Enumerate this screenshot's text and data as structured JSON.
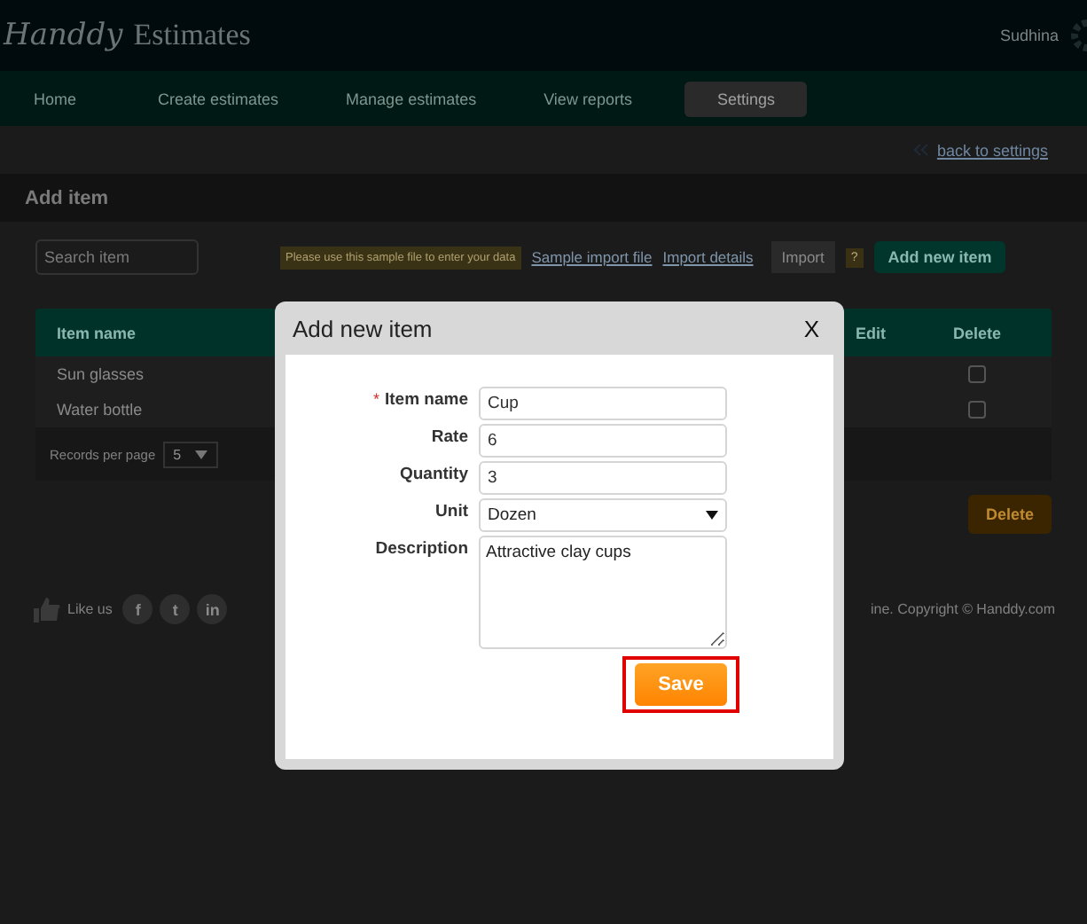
{
  "header": {
    "logo_script": "Handdy",
    "logo_text": "Estimates",
    "user": "Sudhina"
  },
  "nav": [
    {
      "label": "Home",
      "selected": false
    },
    {
      "label": "Create estimates",
      "selected": false
    },
    {
      "label": "Manage estimates",
      "selected": false
    },
    {
      "label": "View reports",
      "selected": false
    },
    {
      "label": "Settings",
      "selected": true
    }
  ],
  "back_link": "back to settings",
  "section_title": "Add item",
  "toolbar": {
    "search_placeholder": "Search item",
    "hint": "Please use this sample file to enter your data",
    "links": [
      "Sample import file",
      "Import details"
    ],
    "import_button": "Import",
    "help": "?",
    "add_button": "Add new item"
  },
  "table": {
    "columns": [
      "Item name",
      "Edit",
      "Delete"
    ],
    "rows": [
      {
        "name": "Sun glasses",
        "checked": false
      },
      {
        "name": "Water bottle",
        "checked": false
      }
    ]
  },
  "records_per_page": {
    "label": "Records per page",
    "value": "5"
  },
  "delete_button": "Delete",
  "footer": {
    "like": "Like us",
    "social": [
      "f",
      "t",
      "in"
    ],
    "copyright": "ine. Copyright © Handdy.com"
  },
  "modal": {
    "title": "Add new item",
    "close": "X",
    "required_mark": "*",
    "fields": [
      {
        "label": "Item name",
        "kind": "text",
        "required": true,
        "value": "Cup"
      },
      {
        "label": "Rate",
        "kind": "text",
        "required": false,
        "value": "6"
      },
      {
        "label": "Quantity",
        "kind": "text",
        "required": false,
        "value": "3"
      },
      {
        "label": "Unit",
        "kind": "select",
        "required": false,
        "value": "Dozen"
      },
      {
        "label": "Description",
        "kind": "textarea",
        "required": false,
        "value": "Attractive clay cups"
      }
    ],
    "save_button": "Save",
    "save_highlighted": true
  }
}
